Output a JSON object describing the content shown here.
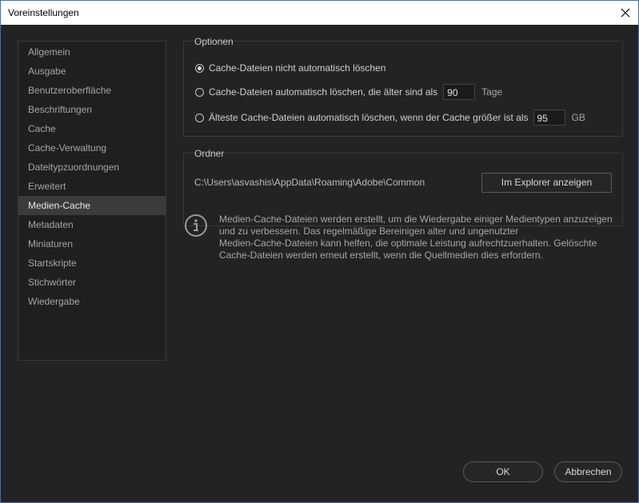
{
  "window": {
    "title": "Voreinstellungen"
  },
  "sidebar": {
    "items": [
      {
        "label": "Allgemein"
      },
      {
        "label": "Ausgabe"
      },
      {
        "label": "Benutzeroberfläche"
      },
      {
        "label": "Beschriftungen"
      },
      {
        "label": "Cache"
      },
      {
        "label": "Cache-Verwaltung"
      },
      {
        "label": "Dateitypzuordnungen"
      },
      {
        "label": "Erweitert"
      },
      {
        "label": "Medien-Cache",
        "selected": true
      },
      {
        "label": "Metadaten"
      },
      {
        "label": "Miniaturen"
      },
      {
        "label": "Startskripte"
      },
      {
        "label": "Stichwörter"
      },
      {
        "label": "Wiedergabe"
      }
    ]
  },
  "options": {
    "title": "Optionen",
    "no_auto_delete": {
      "label": "Cache-Dateien nicht automatisch löschen",
      "checked": true
    },
    "delete_older": {
      "label": "Cache-Dateien automatisch löschen, die älter sind als",
      "value": "90",
      "unit": "Tage",
      "checked": false
    },
    "delete_oldest": {
      "label": "Älteste Cache-Dateien automatisch löschen, wenn der Cache größer ist als",
      "value": "95",
      "unit": "GB",
      "checked": false
    }
  },
  "folder": {
    "title": "Ordner",
    "path": "C:\\Users\\asvashis\\AppData\\Roaming\\Adobe\\Common",
    "explorer_button": "Im Explorer anzeigen"
  },
  "info": {
    "icon": "info-icon",
    "text_lines": [
      "Medien-Cache-Dateien werden erstellt, um die Wiedergabe einiger Medientypen anzuzeigen",
      "und zu verbessern. Das regelmäßige Bereinigen alter und ungenutzter",
      "Medien-Cache-Dateien kann helfen, die optimale Leistung aufrechtzuerhalten. Gelöschte",
      "Cache-Dateien werden erneut erstellt, wenn die Quellmedien dies erfordern."
    ]
  },
  "footer": {
    "ok_label": "OK",
    "cancel_label": "Abbrechen"
  }
}
